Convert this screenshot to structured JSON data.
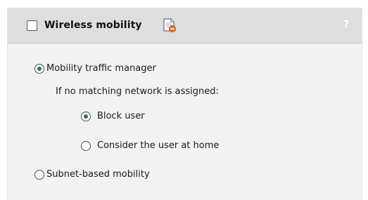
{
  "header": {
    "title": "Wireless mobility",
    "checkbox_checked": false,
    "doc_icon": "document-edit-icon",
    "help_label": "?"
  },
  "options": {
    "mobility_traffic_manager": {
      "label": "Mobility traffic manager",
      "selected": true
    },
    "no_match_prompt": "If no matching network is assigned:",
    "block_user": {
      "label": "Block user",
      "selected": true
    },
    "consider_home": {
      "label": "Consider the user at home",
      "selected": false
    },
    "subnet_based": {
      "label": "Subnet-based mobility",
      "selected": false
    }
  },
  "colors": {
    "header_bg": "#dedede",
    "panel_bg": "#f2f2f2",
    "radio_dot": "#2a7a3a"
  }
}
